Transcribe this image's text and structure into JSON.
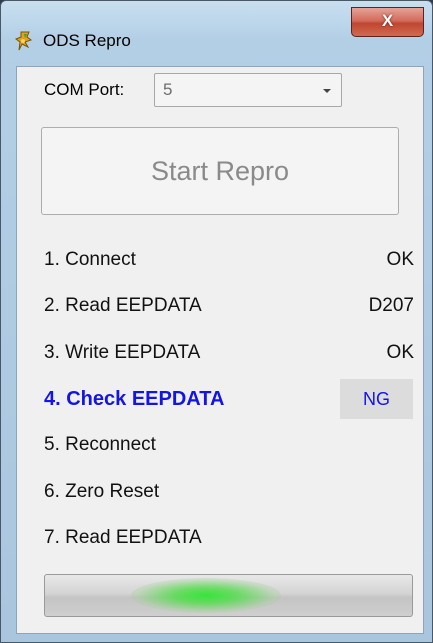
{
  "window": {
    "title": "ODS Repro",
    "close_label": "X",
    "icon": "app-icon"
  },
  "com_port": {
    "label": "COM Port:",
    "value": "5",
    "icon": "chevron-down-icon"
  },
  "start_button": {
    "label": "Start Repro",
    "enabled": false
  },
  "steps": [
    {
      "label": "1. Connect",
      "result": "OK"
    },
    {
      "label": "2. Read EEPDATA",
      "result": "D207"
    },
    {
      "label": "3. Write EEPDATA",
      "result": "OK"
    },
    {
      "label": "4. Check EEPDATA",
      "result": "NG",
      "active": true
    },
    {
      "label": "5. Reconnect",
      "result": ""
    },
    {
      "label": "6. Zero Reset",
      "result": ""
    },
    {
      "label": "7. Read EEPDATA",
      "result": ""
    }
  ],
  "progress": {
    "style": "marquee",
    "glow_color": "#37e43d"
  },
  "colors": {
    "active_step": "#1414e6",
    "close_button": "#c04632"
  }
}
